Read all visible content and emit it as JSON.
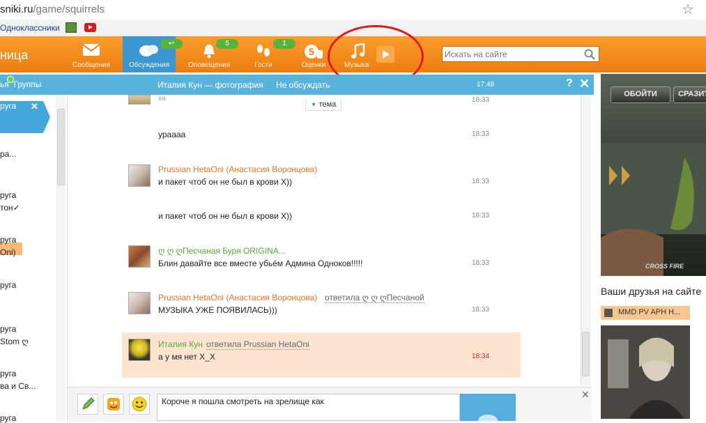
{
  "address_bar": {
    "host": "sniki.ru",
    "path": "/game/squirrels"
  },
  "bookmarks": {
    "items": [
      "Одноклассники"
    ]
  },
  "nav": {
    "brand": "ница",
    "items": [
      {
        "label": "Сообщения"
      },
      {
        "label": "Обсуждения",
        "active": true
      },
      {
        "label": "Оповещения",
        "badge": "5"
      },
      {
        "label": "Гости",
        "badge": "1"
      },
      {
        "label": "Оценки"
      },
      {
        "label": "Музыка"
      }
    ],
    "search_placeholder": "Искать на сайте"
  },
  "chat": {
    "left_tabs": "ья  Группы",
    "title": "Италия Кун — фотография",
    "not_discuss": "Не обсуждать",
    "time": "17:48",
    "help": "?",
    "close": "✕",
    "topic": "тема",
    "sidebar": [
      {
        "lines": [
          "руга"
        ]
      },
      {
        "lines": [
          "ра..."
        ]
      },
      {
        "lines": [
          "руга",
          "тон✓"
        ]
      },
      {
        "lines": [
          "руга",
          "Oni)"
        ]
      },
      {
        "lines": [
          "руга"
        ]
      },
      {
        "lines": [
          "руга",
          "Stom ღ"
        ]
      },
      {
        "lines": [
          "руга",
          "ва и Св..."
        ]
      },
      {
        "lines": [
          "руга"
        ]
      }
    ],
    "messages": [
      {
        "text": "ха",
        "time": "18:33"
      },
      {
        "text": "ураааа",
        "time": "18:33"
      },
      {
        "author": "Prussian HetaOni (Анастасия Воронцова)",
        "text": "и пакет чтоб он не был в крови Х))",
        "time": "18:33"
      },
      {
        "text": "и пакет чтоб он не был в крови Х))",
        "time": "18:33"
      },
      {
        "author": "ღ ღ ღПесчаная Буря ORIGINA...",
        "text": "Блин давайте все вместе убьём Админа Одноков!!!!!",
        "time": "18:33"
      },
      {
        "author": "Prussian HetaOni (Анастасия Воронцова)",
        "reply": "ответила ღ ღ ღПесчаной",
        "text": "МУЗЫКА УЖЕ ПОЯВИЛАСЬ)))",
        "time": "18:33"
      },
      {
        "author": "Италия Кун",
        "reply": "ответила Prussian HetaOni",
        "text": "а у мя нет Х_Х",
        "time": "18:34"
      }
    ],
    "composer_text": "Короче я пошла смотреть на зрелище как"
  },
  "ad": {
    "buttons": [
      "ОБОЙТИ",
      "СРАЗИТ"
    ],
    "game_logo": "CROSS FIRE",
    "friends_title": "Ваши друзья на сайте",
    "video_title": "MMD PV APH Н..."
  },
  "colors": {
    "nav_orange": "#f28a1e",
    "chat_blue": "#58b3dc",
    "highlight_peach": "#fce4d0",
    "annotation_red": "#e5161e",
    "author_orange": "#e0762a",
    "author_green": "#55a83a"
  }
}
